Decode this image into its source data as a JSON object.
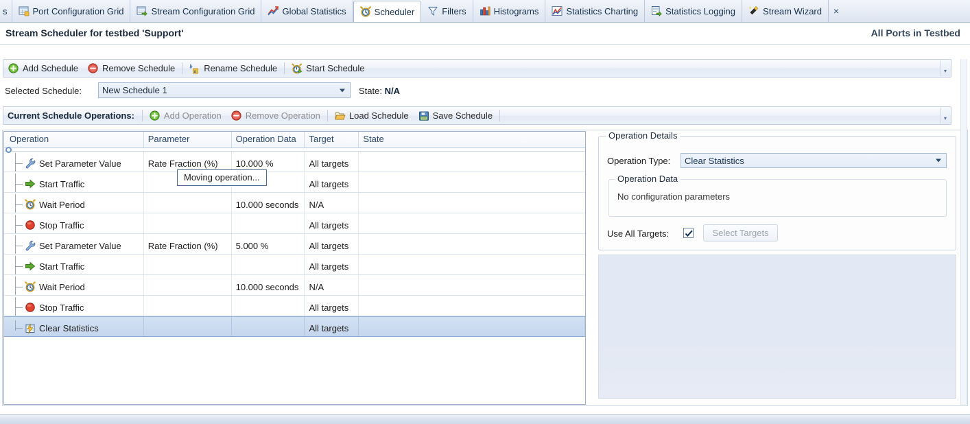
{
  "tabs": [
    {
      "label": "s",
      "icon": "clipped-tab",
      "active": false,
      "clipped": true
    },
    {
      "label": "Port Configuration Grid",
      "icon": "grid-icon",
      "active": false
    },
    {
      "label": "Stream Configuration Grid",
      "icon": "grid-arrow-icon",
      "active": false
    },
    {
      "label": "Global Statistics",
      "icon": "chart-line-icon",
      "active": false
    },
    {
      "label": "Scheduler",
      "icon": "clock-icon",
      "active": true
    },
    {
      "label": "Filters",
      "icon": "funnel-icon",
      "active": false
    },
    {
      "label": "Histograms",
      "icon": "bar-chart-icon",
      "active": false
    },
    {
      "label": "Statistics Charting",
      "icon": "area-chart-icon",
      "active": false
    },
    {
      "label": "Statistics Logging",
      "icon": "log-icon",
      "active": false
    },
    {
      "label": "Stream Wizard",
      "icon": "wand-icon",
      "active": false
    }
  ],
  "tab_close_label": "×",
  "header": {
    "title": "Stream Scheduler for testbed 'Support'",
    "scope": "All Ports in Testbed"
  },
  "schedule_toolbar": {
    "items": [
      {
        "label": "Add Schedule",
        "icon": "add-green-icon"
      },
      {
        "label": "Remove Schedule",
        "icon": "remove-red-icon"
      },
      {
        "label": "Rename Schedule",
        "icon": "rename-ab-icon"
      },
      {
        "label": "Start Schedule",
        "icon": "start-clock-icon"
      }
    ]
  },
  "selected_schedule": {
    "label": "Selected Schedule:",
    "value": "New Schedule 1",
    "state_label": "State:",
    "state_value": "N/A"
  },
  "operations_toolbar": {
    "title": "Current Schedule Operations:",
    "items": [
      {
        "label": "Add Operation",
        "icon": "add-green-icon",
        "disabled": true
      },
      {
        "label": "Remove Operation",
        "icon": "remove-red-icon",
        "disabled": true
      },
      {
        "label": "Load Schedule",
        "icon": "folder-open-icon",
        "disabled": false
      },
      {
        "label": "Save Schedule",
        "icon": "floppy-save-icon",
        "disabled": false
      }
    ]
  },
  "grid": {
    "columns": [
      "Operation",
      "Parameter",
      "Operation Data",
      "Target",
      "State"
    ],
    "rows": [
      {
        "operation": "Set Parameter Value",
        "icon": "wrench-icon",
        "parameter": "Rate Fraction (%)",
        "data": "10.000 %",
        "target": "All targets",
        "state": "",
        "selected": false
      },
      {
        "operation": "Start Traffic",
        "icon": "green-arrow-icon",
        "parameter": "",
        "data": "",
        "target": "All targets",
        "state": "",
        "selected": false
      },
      {
        "operation": "Wait Period",
        "icon": "alarm-clock-icon",
        "parameter": "",
        "data": "10.000 seconds",
        "target": "N/A",
        "state": "",
        "selected": false
      },
      {
        "operation": "Stop Traffic",
        "icon": "red-stop-icon",
        "parameter": "",
        "data": "",
        "target": "All targets",
        "state": "",
        "selected": false
      },
      {
        "operation": "Set Parameter Value",
        "icon": "wrench-icon",
        "parameter": "Rate Fraction (%)",
        "data": "5.000 %",
        "target": "All targets",
        "state": "",
        "selected": false
      },
      {
        "operation": "Start Traffic",
        "icon": "green-arrow-icon",
        "parameter": "",
        "data": "",
        "target": "All targets",
        "state": "",
        "selected": false
      },
      {
        "operation": "Wait Period",
        "icon": "alarm-clock-icon",
        "parameter": "",
        "data": "10.000 seconds",
        "target": "N/A",
        "state": "",
        "selected": false
      },
      {
        "operation": "Stop Traffic",
        "icon": "red-stop-icon",
        "parameter": "",
        "data": "",
        "target": "All targets",
        "state": "",
        "selected": false
      },
      {
        "operation": "Clear Statistics",
        "icon": "clear-stats-icon",
        "parameter": "",
        "data": "",
        "target": "All targets",
        "state": "",
        "selected": true
      }
    ]
  },
  "tooltip": {
    "text": "Moving operation..."
  },
  "details": {
    "group_title": "Operation Details",
    "op_type_label": "Operation Type:",
    "op_type_value": "Clear Statistics",
    "data_group_title": "Operation Data",
    "data_group_body": "No configuration parameters",
    "use_all_targets_label": "Use All Targets:",
    "use_all_targets_checked": true,
    "select_targets_label": "Select Targets"
  },
  "colors": {
    "tab_active_bg": "#ffffff",
    "tabbar_bg": "#e6ecf5",
    "accent_border": "#a8bcd6",
    "selected_row": "#c4d6ed",
    "green": "#4e9a2f",
    "red": "#cc3b29",
    "blue_pane": "#e2e8f4"
  }
}
